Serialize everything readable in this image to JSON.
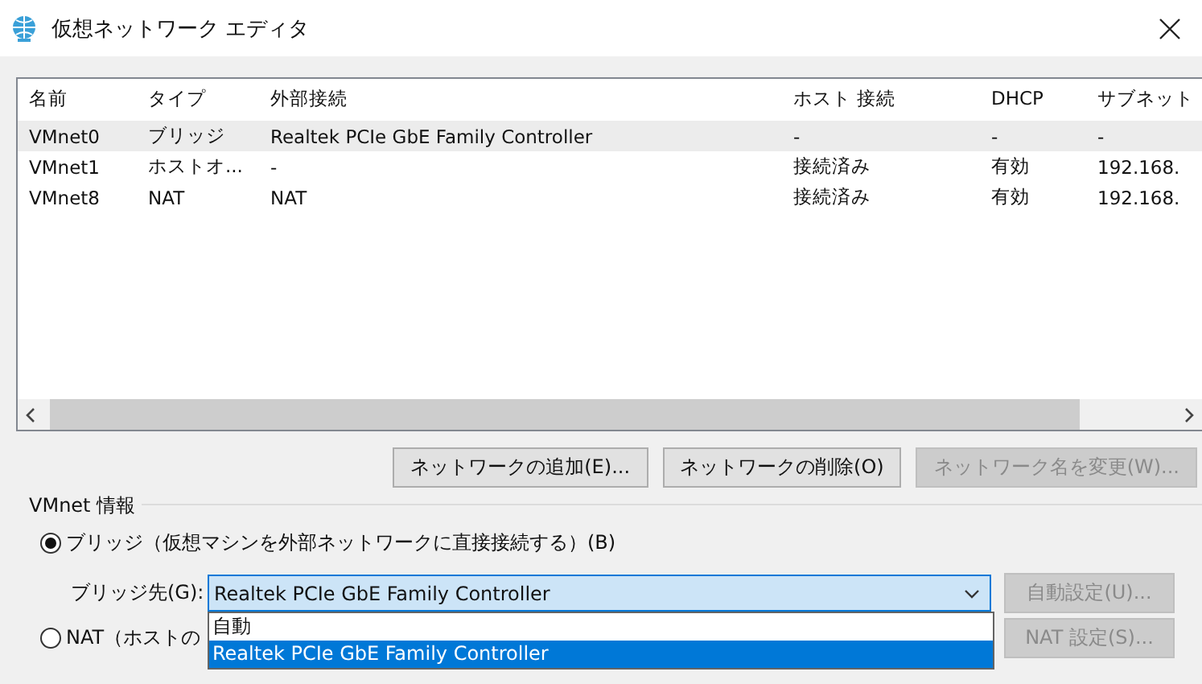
{
  "window": {
    "title": "仮想ネットワーク エディタ"
  },
  "table": {
    "columns": [
      "名前",
      "タイプ",
      "外部接続",
      "ホスト 接続",
      "DHCP",
      "サブネット"
    ],
    "rows": [
      {
        "cells": [
          "VMnet0",
          "ブリッジ",
          "Realtek PCIe GbE Family Controller",
          "-",
          "-",
          "-"
        ],
        "selected": true
      },
      {
        "cells": [
          "VMnet1",
          "ホストオ...",
          "-",
          "接続済み",
          "有効",
          "192.168."
        ],
        "selected": false
      },
      {
        "cells": [
          "VMnet8",
          "NAT",
          "NAT",
          "接続済み",
          "有効",
          "192.168."
        ],
        "selected": false
      }
    ]
  },
  "buttons": [
    {
      "label": "ネットワークの追加(E)...",
      "disabled": false
    },
    {
      "label": "ネットワークの削除(O)",
      "disabled": false
    },
    {
      "label": "ネットワーク名を変更(W)...",
      "disabled": true
    }
  ],
  "vmnet_info": {
    "title": "VMnet 情報",
    "bridge_option": {
      "label": "ブリッジ（仮想マシンを外部ネットワークに直接接続する）(B)",
      "selected": true
    },
    "bridge_to": {
      "label": "ブリッジ先(G):",
      "value": "Realtek PCIe GbE Family Controller",
      "options": [
        {
          "label": "自動",
          "selected": false
        },
        {
          "label": "Realtek PCIe GbE Family Controller",
          "selected": true
        }
      ]
    },
    "auto_button": {
      "label": "自動設定(U)...",
      "disabled": true
    },
    "nat_option": {
      "label": "NAT（ホストの",
      "selected": false
    },
    "nat_button": {
      "label": "NAT 設定(S)...",
      "disabled": true
    }
  }
}
